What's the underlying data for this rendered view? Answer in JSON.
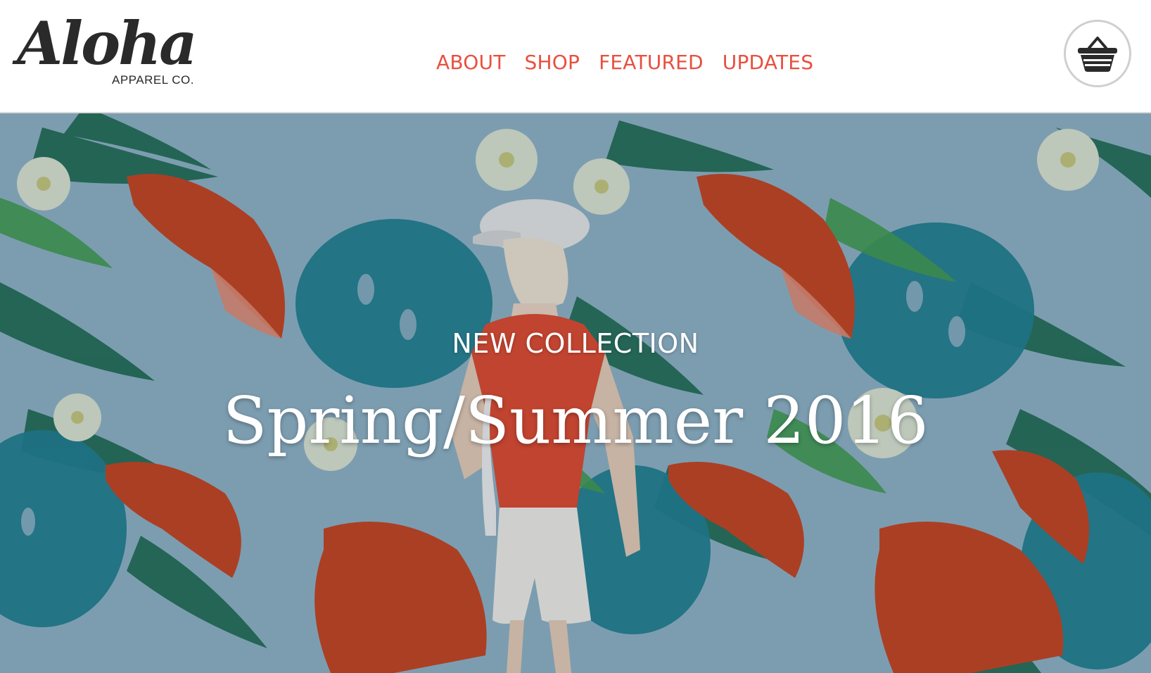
{
  "brand": {
    "logo_text": "Aloha",
    "logo_subtext": "APPAREL CO."
  },
  "nav": {
    "items": [
      {
        "label": "ABOUT"
      },
      {
        "label": "SHOP"
      },
      {
        "label": "FEATURED"
      },
      {
        "label": "UPDATES"
      }
    ],
    "color": "#e8503f"
  },
  "cart": {
    "icon": "basket-icon"
  },
  "hero": {
    "kicker": "NEW COLLECTION",
    "title": "Spring/Summer 2016"
  }
}
